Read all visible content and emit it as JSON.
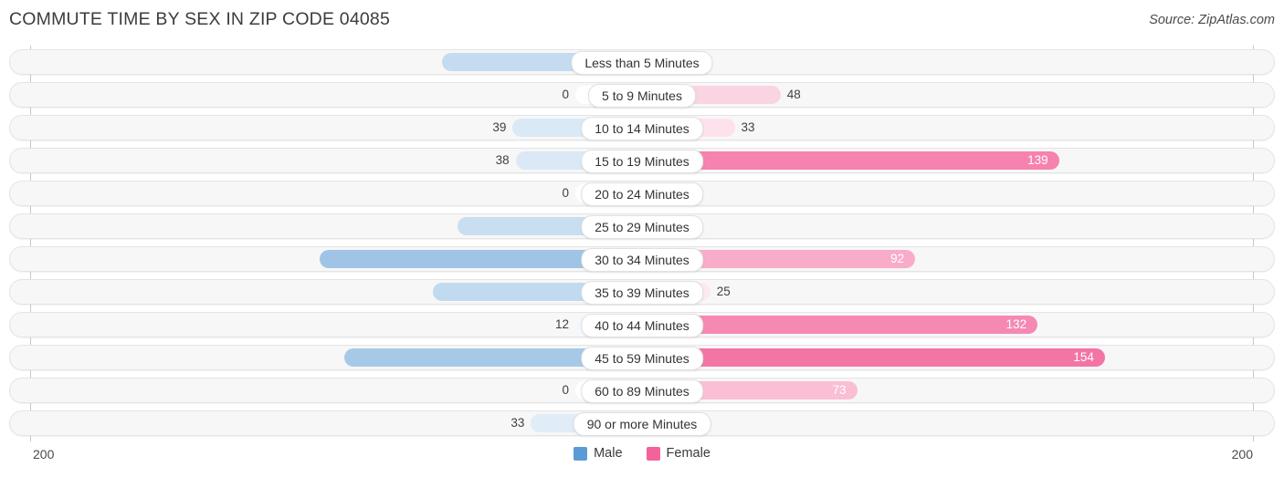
{
  "header": {
    "title": "COMMUTE TIME BY SEX IN ZIP CODE 04085",
    "source": "Source: ZipAtlas.com"
  },
  "legend": {
    "male_label": "Male",
    "female_label": "Female",
    "male_color": "#5b9bd5",
    "female_color": "#f2639b"
  },
  "axis": {
    "left_tick": "200",
    "right_tick": "200"
  },
  "chart_data": {
    "type": "bar",
    "title": "COMMUTE TIME BY SEX IN ZIP CODE 04085",
    "xlabel": "",
    "ylabel": "",
    "orientation": "horizontal-diverging",
    "xlim": [
      200,
      200
    ],
    "grid": false,
    "legend_position": "bottom-center",
    "categories": [
      "Less than 5 Minutes",
      "5 to 9 Minutes",
      "10 to 14 Minutes",
      "15 to 19 Minutes",
      "20 to 24 Minutes",
      "25 to 29 Minutes",
      "30 to 34 Minutes",
      "35 to 39 Minutes",
      "40 to 44 Minutes",
      "45 to 59 Minutes",
      "60 to 89 Minutes",
      "90 or more Minutes"
    ],
    "series": [
      {
        "name": "Male",
        "color": "#5b9bd5",
        "direction": "left",
        "values": [
          62,
          0,
          39,
          38,
          0,
          57,
          102,
          65,
          12,
          94,
          0,
          33
        ],
        "labels": [
          "62",
          "0",
          "39",
          "38",
          "0",
          "57",
          "102",
          "65",
          "12",
          "94",
          "0",
          "33"
        ]
      },
      {
        "name": "Female",
        "color": "#f2639b",
        "direction": "right",
        "values": [
          0,
          48,
          33,
          139,
          0,
          0,
          92,
          25,
          132,
          154,
          73,
          0
        ],
        "labels": [
          "0",
          "48",
          "33",
          "139",
          "0",
          "0",
          "92",
          "25",
          "132",
          "154",
          "73",
          "0"
        ]
      }
    ]
  }
}
